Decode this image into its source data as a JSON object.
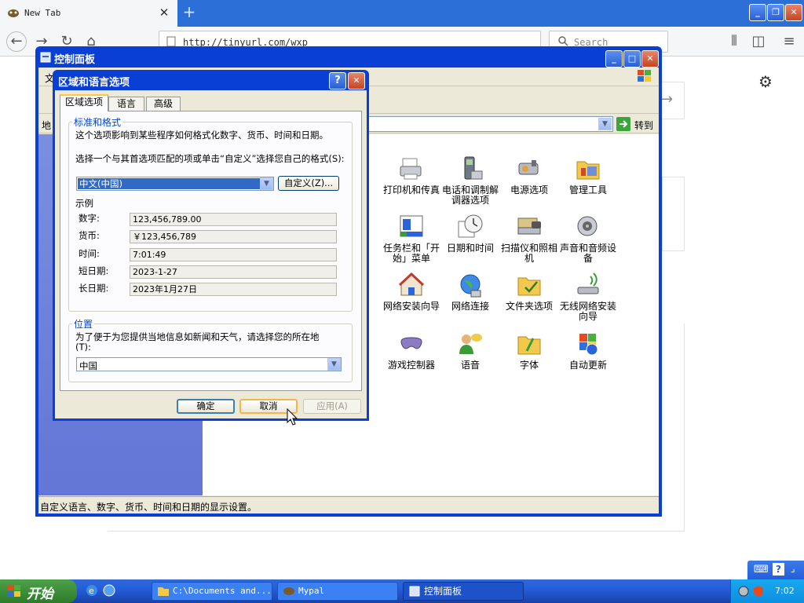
{
  "browser": {
    "tab_title": "New Tab",
    "tab_close": "✕",
    "new_tab": "+",
    "url": "http://tinyurl.com/wxp",
    "search_placeholder": "Search"
  },
  "control_panel": {
    "title": "控制面板",
    "go_button": "转到",
    "status_text": "自定义语言、数字、货币、时间和日期的显示设置。",
    "menu_partial": "文",
    "addr_partial": "地",
    "items": [
      {
        "label": "打印机和传真",
        "icon": "printer-icon"
      },
      {
        "label": "电话和调制解调器选项",
        "icon": "phone-icon"
      },
      {
        "label": "电源选项",
        "icon": "power-icon"
      },
      {
        "label": "管理工具",
        "icon": "admin-tools-icon"
      },
      {
        "label": "任务栏和「开始」菜单",
        "icon": "taskbar-icon"
      },
      {
        "label": "日期和时间",
        "icon": "clock-icon"
      },
      {
        "label": "扫描仪和照相机",
        "icon": "scanner-icon"
      },
      {
        "label": "声音和音频设备",
        "icon": "speaker-icon"
      },
      {
        "label": "网络安装向导",
        "icon": "home-network-icon"
      },
      {
        "label": "网络连接",
        "icon": "globe-icon"
      },
      {
        "label": "文件夹选项",
        "icon": "folder-options-icon"
      },
      {
        "label": "无线网络安装向导",
        "icon": "wireless-icon"
      },
      {
        "label": "游戏控制器",
        "icon": "gamepad-icon"
      },
      {
        "label": "语音",
        "icon": "speech-icon"
      },
      {
        "label": "字体",
        "icon": "fonts-icon"
      },
      {
        "label": "自动更新",
        "icon": "windows-update-icon"
      }
    ]
  },
  "dialog": {
    "title": "区域和语言选项",
    "help": "?",
    "close": "✕",
    "tabs": [
      "区域选项",
      "语言",
      "高级"
    ],
    "standards_group": "标准和格式",
    "standards_desc": "这个选项影响到某些程序如何格式化数字、货币、时间和日期。",
    "select_desc": "选择一个与其首选项匹配的项或单击“自定义”选择您自己的格式(S):",
    "format_value": "中文(中国)",
    "customize_button": "自定义(Z)...",
    "samples_label": "示例",
    "samples": [
      {
        "label": "数字:",
        "value": "123,456,789.00"
      },
      {
        "label": "货币:",
        "value": "￥123,456,789"
      },
      {
        "label": "时间:",
        "value": "7:01:49"
      },
      {
        "label": "短日期:",
        "value": "2023-1-27"
      },
      {
        "label": "长日期:",
        "value": "2023年1月27日"
      }
    ],
    "location_group": "位置",
    "location_desc": "为了便于为您提供当地信息如新闻和天气，请选择您的所在地(T):",
    "location_value": "中国",
    "ok_button": "确定",
    "cancel_button": "取消",
    "apply_button": "应用(A)"
  },
  "taskbar": {
    "start_label": "开始",
    "tasks": [
      "C:\\Documents and...",
      "Mypal",
      "控制面板"
    ],
    "clock": "7:02",
    "colors": {
      "start": "#3c8f38",
      "bar": "#245edb"
    }
  }
}
